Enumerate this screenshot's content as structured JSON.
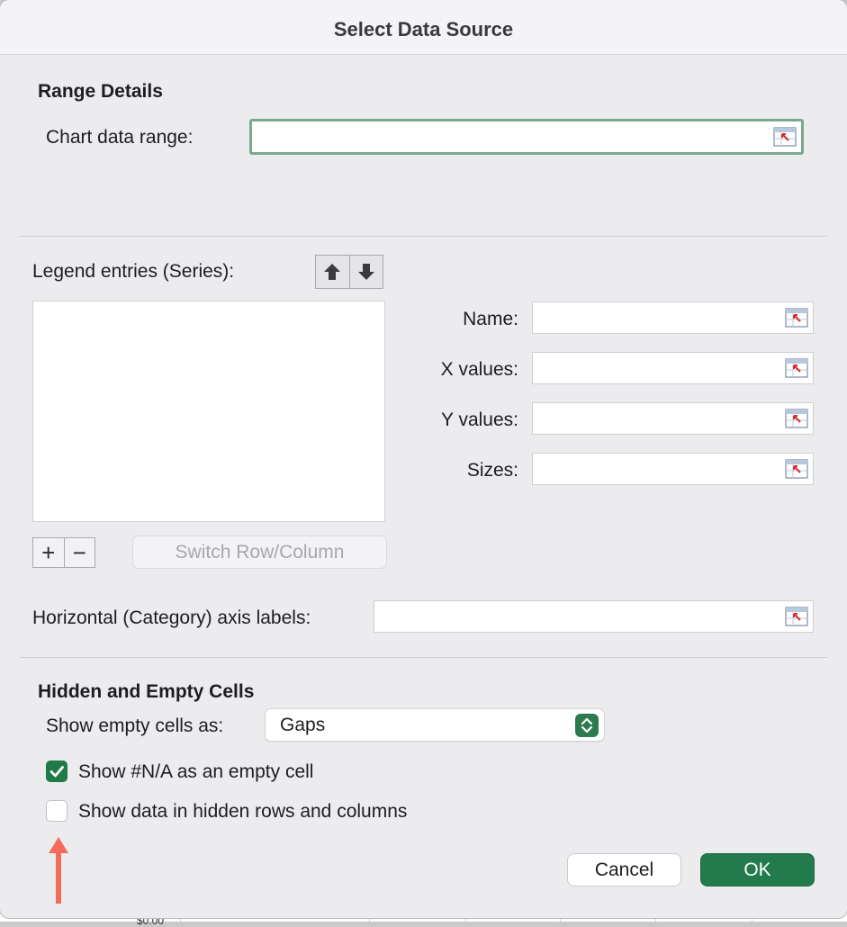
{
  "dialog": {
    "title": "Select Data Source"
  },
  "range_details": {
    "heading": "Range Details",
    "chart_data_range_label": "Chart data range:",
    "chart_data_range_value": ""
  },
  "series": {
    "legend_label": "Legend entries (Series):",
    "items": [],
    "fields": {
      "name_label": "Name:",
      "x_values_label": "X values:",
      "y_values_label": "Y values:",
      "sizes_label": "Sizes:",
      "name_value": "",
      "x_values_value": "",
      "y_values_value": "",
      "sizes_value": ""
    },
    "add_symbol": "+",
    "remove_symbol": "−",
    "switch_label": "Switch Row/Column"
  },
  "axis": {
    "horizontal_label": "Horizontal (Category) axis labels:",
    "horizontal_value": ""
  },
  "hidden_empty": {
    "heading": "Hidden and Empty Cells",
    "show_empty_label": "Show empty cells as:",
    "show_empty_value": "Gaps",
    "na_checkbox_label": "Show #N/A as an empty cell",
    "na_checked": true,
    "hidden_checkbox_label": "Show data in hidden rows and columns",
    "hidden_checked": false
  },
  "buttons": {
    "cancel": "Cancel",
    "ok": "OK"
  },
  "colors": {
    "accent_green": "#237b4d",
    "focus_border": "#7aa98f",
    "annotation_arrow": "#f26b5b"
  },
  "background": {
    "partial_cell_text": "$0.00"
  }
}
